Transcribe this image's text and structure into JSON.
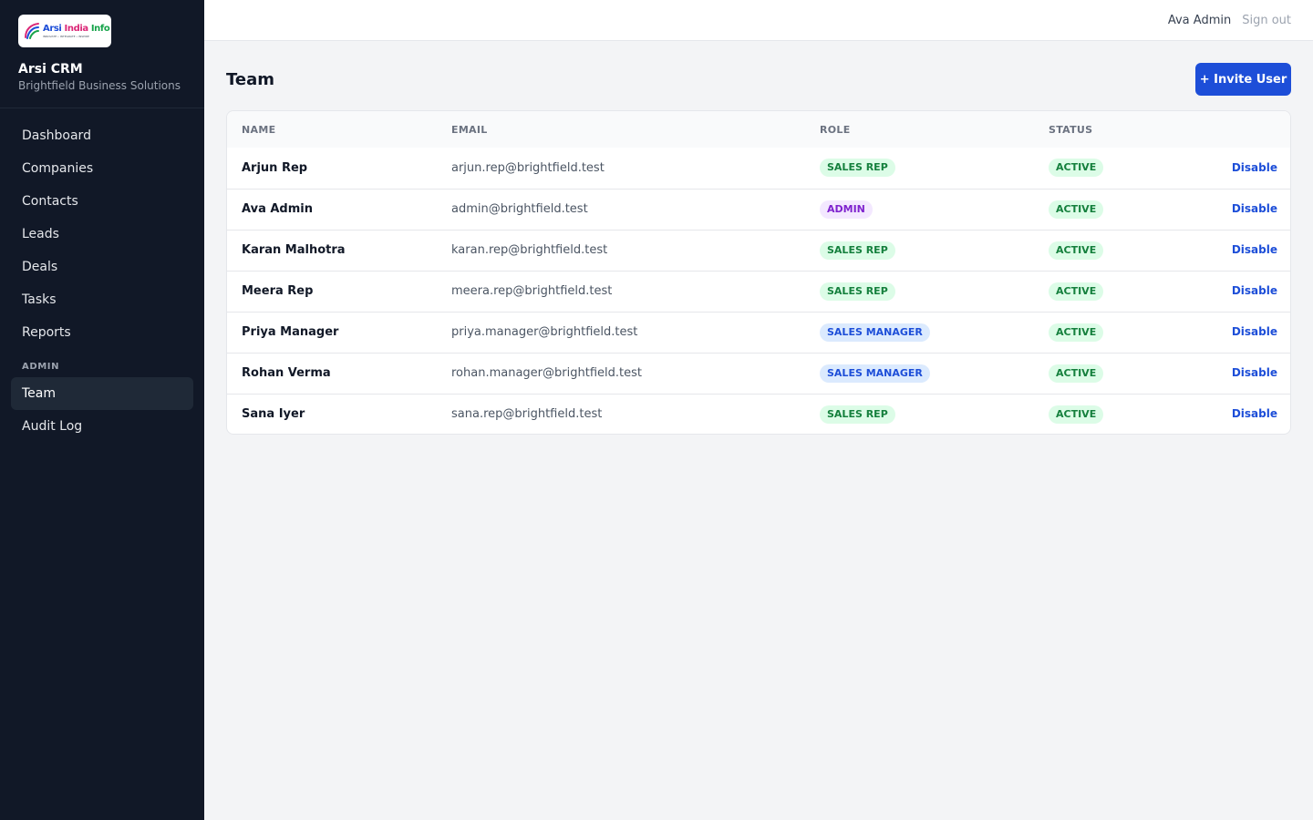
{
  "brand": {
    "logo_text": [
      "Arsi",
      "India",
      "Info"
    ],
    "logo_tagline": "INNOVATE • INTEGRATE • INSPIRE",
    "app_name": "Arsi CRM",
    "org_name": "Brightfield Business Solutions"
  },
  "nav": {
    "items": [
      {
        "label": "Dashboard",
        "slug": "dashboard"
      },
      {
        "label": "Companies",
        "slug": "companies"
      },
      {
        "label": "Contacts",
        "slug": "contacts"
      },
      {
        "label": "Leads",
        "slug": "leads"
      },
      {
        "label": "Deals",
        "slug": "deals"
      },
      {
        "label": "Tasks",
        "slug": "tasks"
      },
      {
        "label": "Reports",
        "slug": "reports"
      }
    ],
    "admin_section": {
      "title": "ADMIN",
      "items": [
        {
          "label": "Team",
          "slug": "team",
          "active": true
        },
        {
          "label": "Audit Log",
          "slug": "audit-log"
        }
      ]
    }
  },
  "topbar": {
    "user_name": "Ava Admin",
    "signout_label": "Sign out"
  },
  "page": {
    "title": "Team",
    "invite_button": "+ Invite User"
  },
  "table": {
    "columns": [
      "NAME",
      "EMAIL",
      "ROLE",
      "STATUS",
      ""
    ],
    "rows": [
      {
        "name": "Arjun Rep",
        "email": "arjun.rep@brightfield.test",
        "role": "SALES REP",
        "status": "ACTIVE",
        "action": "Disable"
      },
      {
        "name": "Ava Admin",
        "email": "admin@brightfield.test",
        "role": "ADMIN",
        "status": "ACTIVE",
        "action": "Disable"
      },
      {
        "name": "Karan Malhotra",
        "email": "karan.rep@brightfield.test",
        "role": "SALES REP",
        "status": "ACTIVE",
        "action": "Disable"
      },
      {
        "name": "Meera Rep",
        "email": "meera.rep@brightfield.test",
        "role": "SALES REP",
        "status": "ACTIVE",
        "action": "Disable"
      },
      {
        "name": "Priya Manager",
        "email": "priya.manager@brightfield.test",
        "role": "SALES MANAGER",
        "status": "ACTIVE",
        "action": "Disable"
      },
      {
        "name": "Rohan Verma",
        "email": "rohan.manager@brightfield.test",
        "role": "SALES MANAGER",
        "status": "ACTIVE",
        "action": "Disable"
      },
      {
        "name": "Sana Iyer",
        "email": "sana.rep@brightfield.test",
        "role": "SALES REP",
        "status": "ACTIVE",
        "action": "Disable"
      }
    ]
  },
  "colors": {
    "sidebar_bg": "#111827",
    "accent": "#1d4ed8",
    "sales_rep_badge": "#dcfce7",
    "admin_badge": "#f3e8ff",
    "sales_manager_badge": "#dbeafe",
    "active_badge": "#dcfce7"
  }
}
